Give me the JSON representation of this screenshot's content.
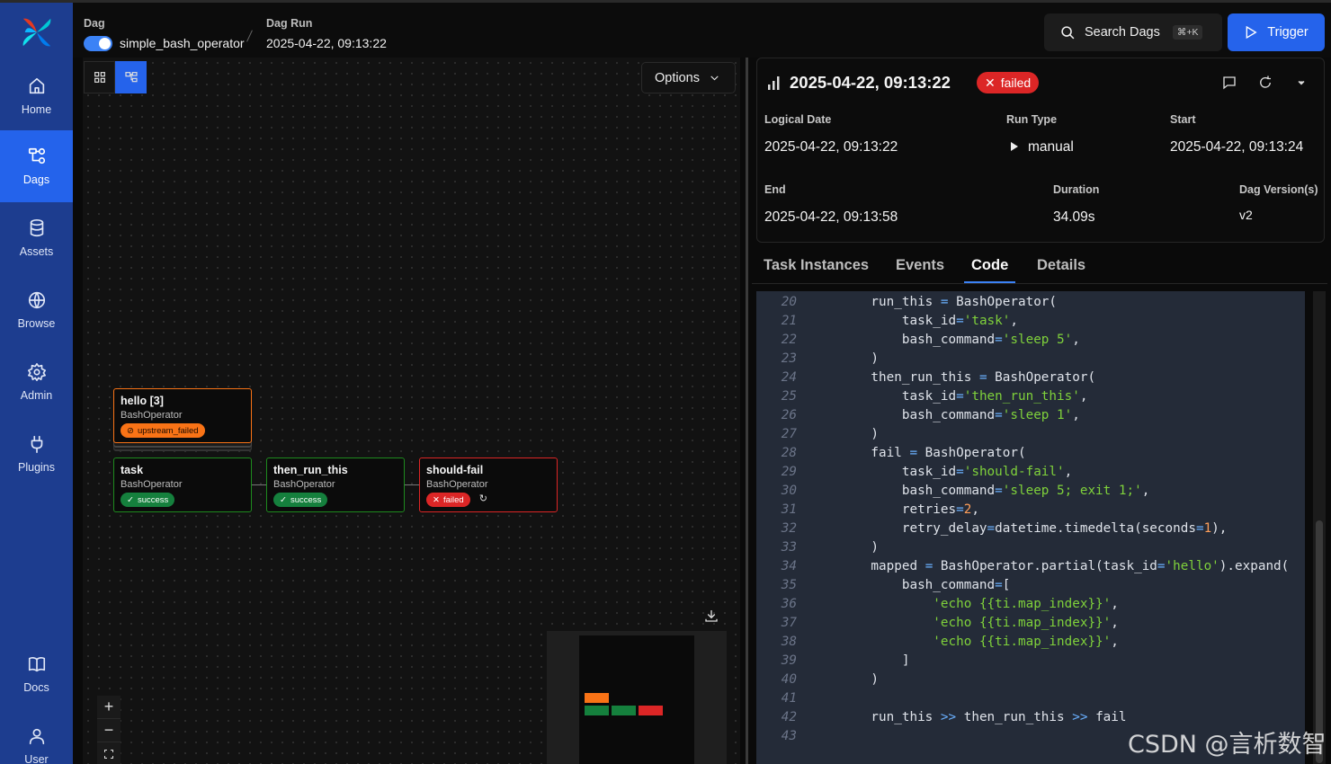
{
  "sidebar": {
    "items": [
      {
        "label": "Home",
        "icon": "home-icon"
      },
      {
        "label": "Dags",
        "icon": "dags-icon",
        "active": true
      },
      {
        "label": "Assets",
        "icon": "database-icon"
      },
      {
        "label": "Browse",
        "icon": "globe-icon"
      },
      {
        "label": "Admin",
        "icon": "gear-icon"
      },
      {
        "label": "Plugins",
        "icon": "plug-icon"
      },
      {
        "label": "Docs",
        "icon": "book-icon"
      },
      {
        "label": "User",
        "icon": "user-icon"
      }
    ]
  },
  "header": {
    "dag_label": "Dag",
    "dag_name": "simple_bash_operator",
    "dag_run_label": "Dag Run",
    "dag_run_value": "2025-04-22, 09:13:22",
    "search_label": "Search Dags",
    "search_shortcut": "⌘+K",
    "trigger_label": "Trigger"
  },
  "graph": {
    "options_label": "Options",
    "nodes": [
      {
        "name": "hello [3]",
        "operator": "BashOperator",
        "state": "upstream_failed"
      },
      {
        "name": "task",
        "operator": "BashOperator",
        "state": "success"
      },
      {
        "name": "then_run_this",
        "operator": "BashOperator",
        "state": "success"
      },
      {
        "name": "should-fail",
        "operator": "BashOperator",
        "state": "failed"
      }
    ],
    "zoom_in": "+",
    "zoom_out": "−"
  },
  "run": {
    "title": "2025-04-22, 09:13:22",
    "state": "failed",
    "fields": {
      "logical_date_label": "Logical Date",
      "logical_date": "2025-04-22, 09:13:22",
      "run_type_label": "Run Type",
      "run_type": "manual",
      "start_label": "Start",
      "start": "2025-04-22, 09:13:24",
      "end_label": "End",
      "end": "2025-04-22, 09:13:58",
      "duration_label": "Duration",
      "duration": "34.09s",
      "version_label": "Dag Version(s)",
      "version": "v2"
    }
  },
  "tabs": [
    "Task Instances",
    "Events",
    "Code",
    "Details"
  ],
  "active_tab": "Code",
  "code": {
    "line_numbers": [
      "20",
      "21",
      "22",
      "23",
      "24",
      "25",
      "26",
      "27",
      "28",
      "29",
      "30",
      "31",
      "32",
      "33",
      "34",
      "35",
      "36",
      "37",
      "38",
      "39",
      "40",
      "41",
      "42",
      "43"
    ],
    "lines": [
      "    run_this = BashOperator(",
      "        task_id='task',",
      "        bash_command='sleep 5',",
      "    )",
      "    then_run_this = BashOperator(",
      "        task_id='then_run_this',",
      "        bash_command='sleep 1',",
      "    )",
      "    fail = BashOperator(",
      "        task_id='should-fail',",
      "        bash_command='sleep 5; exit 1;',",
      "        retries=2,",
      "        retry_delay=datetime.timedelta(seconds=1),",
      "    )",
      "    mapped = BashOperator.partial(task_id='hello').expand(",
      "        bash_command=[",
      "            'echo {{ti.map_index}}',",
      "            'echo {{ti.map_index}}',",
      "            'echo {{ti.map_index}}',",
      "        ]",
      "    )",
      "",
      "    run_this >> then_run_this >> fail",
      ""
    ]
  },
  "watermark": "CSDN @言析数智",
  "colors": {
    "sidebar_bg": "#1d3d8f",
    "accent": "#2563eb",
    "success": "#15803d",
    "failed": "#dc2626",
    "upstream_failed": "#f97316"
  }
}
